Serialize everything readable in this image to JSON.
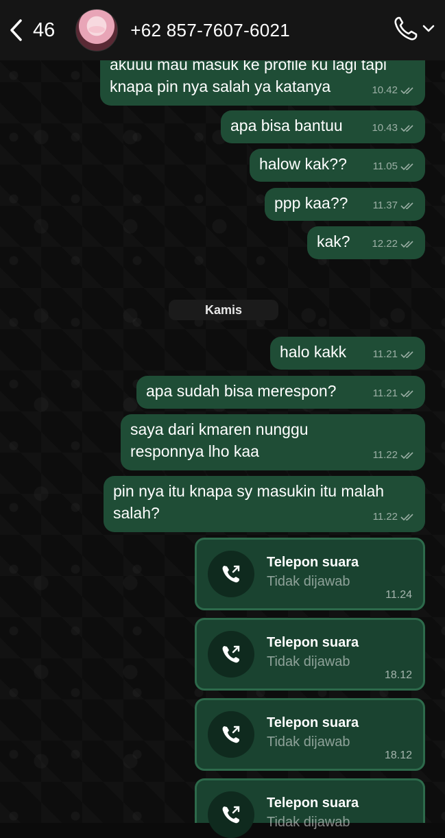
{
  "header": {
    "back_count": "46",
    "contact_name": "+62 857-7607-6021"
  },
  "messages": [
    {
      "text": "akuuu mau masuk ke profile ku lagi tapi knapa pin nya salah ya katanya",
      "time": "10.42"
    },
    {
      "text": "apa bisa bantuu",
      "time": "10.43"
    },
    {
      "text": "halow kak??",
      "time": "11.05"
    },
    {
      "text": "ppp kaa??",
      "time": "11.37"
    },
    {
      "text": "kak?",
      "time": "12.22"
    },
    {
      "text": "halo kakk",
      "time": "11.21"
    },
    {
      "text": "apa sudah bisa merespon?",
      "time": "11.21"
    },
    {
      "text": "saya dari kmaren nunggu responnya lho kaa",
      "time": "11.22"
    },
    {
      "text": "pin nya itu knapa sy masukin itu malah salah?",
      "time": "11.22"
    }
  ],
  "day_separator": "Kamis",
  "calls": [
    {
      "title": "Telepon suara",
      "status": "Tidak dijawab",
      "time": "11.24"
    },
    {
      "title": "Telepon suara",
      "status": "Tidak dijawab",
      "time": "18.12"
    },
    {
      "title": "Telepon suara",
      "status": "Tidak dijawab",
      "time": "18.12"
    },
    {
      "title": "Telepon suara",
      "status": "Tidak dijawab",
      "time": ""
    }
  ],
  "colors": {
    "bubble": "#1f4d36",
    "call_card": "#1a4330",
    "header": "#151515"
  }
}
